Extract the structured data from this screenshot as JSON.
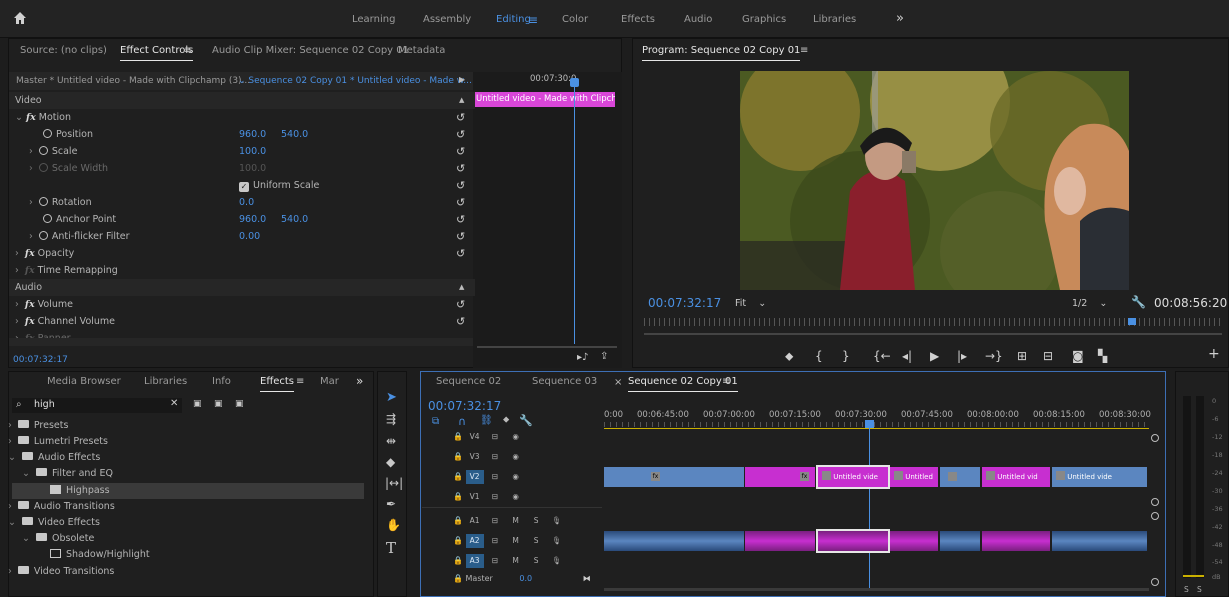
{
  "workspaces": {
    "items": [
      {
        "label": "Learning",
        "active": false
      },
      {
        "label": "Assembly",
        "active": false
      },
      {
        "label": "Editing",
        "active": true
      },
      {
        "label": "Color",
        "active": false
      },
      {
        "label": "Effects",
        "active": false
      },
      {
        "label": "Audio",
        "active": false
      },
      {
        "label": "Graphics",
        "active": false
      },
      {
        "label": "Libraries",
        "active": false
      }
    ],
    "more": "»"
  },
  "source_tabs": {
    "source": "Source: (no clips)",
    "effect_controls": "Effect Controls",
    "audio_mixer": "Audio Clip Mixer: Sequence 02 Copy 01",
    "metadata": "Metadata"
  },
  "effect_controls": {
    "master": "Master * Untitled video - Made with Clipchamp (3)...",
    "sequence": "Sequence 02 Copy 01 * Untitled video - Made w...",
    "timecode": "00:07:30:0",
    "clip_label": "Untitled video - Made with Clipcha",
    "section_video": "Video",
    "motion": "Motion",
    "position": "Position",
    "position_x": "960.0",
    "position_y": "540.0",
    "scale": "Scale",
    "scale_value": "100.0",
    "scale_width": "Scale Width",
    "scale_width_value": "100.0",
    "uniform_scale": "Uniform Scale",
    "rotation": "Rotation",
    "rotation_value": "0.0",
    "anchor_point": "Anchor Point",
    "anchor_x": "960.0",
    "anchor_y": "540.0",
    "anti_flicker": "Anti-flicker Filter",
    "anti_flicker_value": "0.00",
    "opacity": "Opacity",
    "time_remapping": "Time Remapping",
    "section_audio": "Audio",
    "volume": "Volume",
    "channel_volume": "Channel Volume",
    "panner": "Panner",
    "fx_symbol": "fx",
    "current_time": "00:07:32:17"
  },
  "program": {
    "title": "Program: Sequence 02 Copy 01",
    "timecode": "00:07:32:17",
    "fit": "Fit",
    "resolution": "1/2",
    "duration": "00:08:56:20"
  },
  "project_tabs": {
    "media_browser": "Media Browser",
    "libraries": "Libraries",
    "info": "Info",
    "effects": "Effects",
    "markers": "Mar",
    "more": "»"
  },
  "effects_panel": {
    "search_value": "high",
    "tree": [
      {
        "label": "Presets",
        "indent": 0,
        "icon": "folder-star",
        "expanded": false,
        "selected": false
      },
      {
        "label": "Lumetri Presets",
        "indent": 0,
        "icon": "folder-star",
        "expanded": false,
        "selected": false
      },
      {
        "label": "Audio Effects",
        "indent": 0,
        "icon": "folder",
        "expanded": true,
        "selected": false
      },
      {
        "label": "Filter and EQ",
        "indent": 1,
        "icon": "folder",
        "expanded": true,
        "selected": false
      },
      {
        "label": "Highpass",
        "indent": 2,
        "icon": "audio-effect",
        "expanded": false,
        "selected": true
      },
      {
        "label": "Audio Transitions",
        "indent": 0,
        "icon": "folder",
        "expanded": false,
        "selected": false
      },
      {
        "label": "Video Effects",
        "indent": 0,
        "icon": "folder",
        "expanded": true,
        "selected": false
      },
      {
        "label": "Obsolete",
        "indent": 1,
        "icon": "folder",
        "expanded": true,
        "selected": false
      },
      {
        "label": "Shadow/Highlight",
        "indent": 2,
        "icon": "video-effect",
        "expanded": false,
        "selected": false
      },
      {
        "label": "Video Transitions",
        "indent": 0,
        "icon": "folder",
        "expanded": false,
        "selected": false
      }
    ]
  },
  "timeline": {
    "tabs": [
      "Sequence 02",
      "Sequence 03",
      "Sequence 02 Copy 01"
    ],
    "timecode": "00:07:32:17",
    "ruler": [
      "0:00",
      "00:06:45:00",
      "00:07:00:00",
      "00:07:15:00",
      "00:07:30:00",
      "00:07:45:00",
      "00:08:00:00",
      "00:08:15:00",
      "00:08:30:00"
    ],
    "video_tracks": [
      "V4",
      "V3",
      "V2",
      "V1"
    ],
    "audio_tracks": [
      "A1",
      "A2",
      "A3"
    ],
    "master_label": "Master",
    "master_value": "0.0",
    "m_label": "M",
    "s_label": "S",
    "clip_titles": [
      "Untitled vide",
      "Untitled",
      "Untitled vid",
      "Untitled vide"
    ],
    "fx_badge": "fx"
  },
  "meter": {
    "db_labels": [
      "0",
      "-6",
      "-12",
      "-18",
      "-24",
      "-30",
      "-36",
      "-42",
      "-48",
      "-54",
      "dB"
    ],
    "solo_left": "S",
    "solo_right": "S"
  }
}
